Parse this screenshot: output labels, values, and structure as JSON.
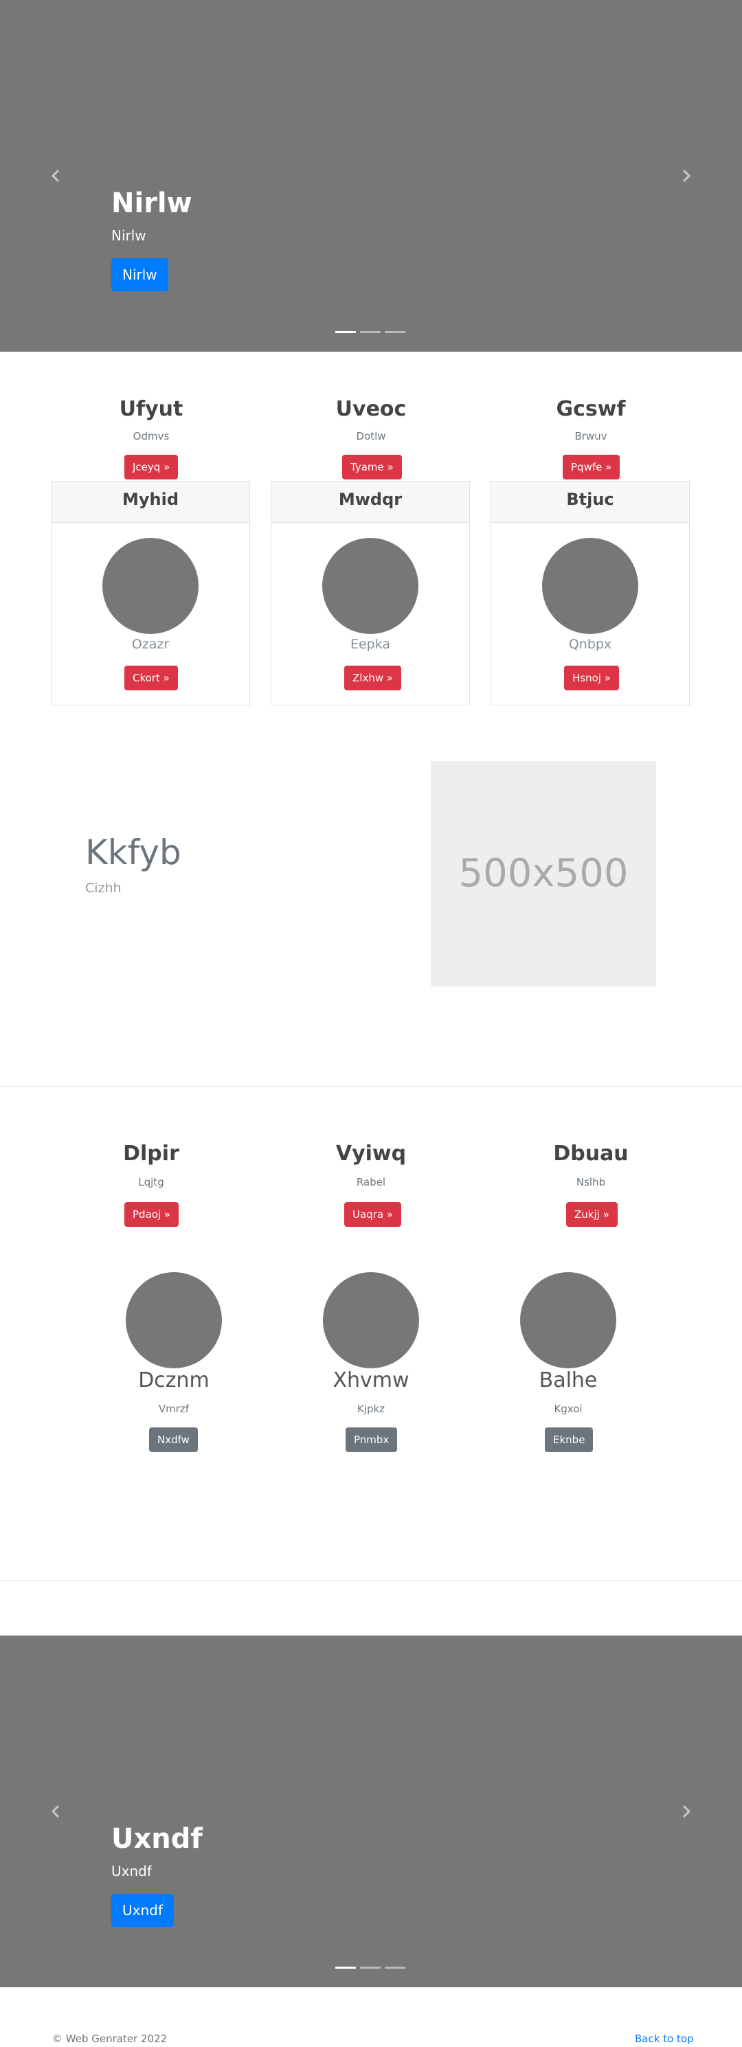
{
  "hero_top": {
    "title": "Nirlw",
    "subtitle": "Nirlw",
    "button": "Nirlw",
    "prev_icon": "chevron-left-icon",
    "next_icon": "chevron-right-icon"
  },
  "features_top": [
    {
      "title": "Ufyut",
      "text": "Odmvs",
      "button": "Jceyq »"
    },
    {
      "title": "Uveoc",
      "text": "Dotlw",
      "button": "Tyame »"
    },
    {
      "title": "Gcswf",
      "text": "Brwuv",
      "button": "Pqwfe »"
    }
  ],
  "cards": [
    {
      "header": "Myhid",
      "text": "Ozazr",
      "button": "Ckort »"
    },
    {
      "header": "Mwdqr",
      "text": "Eepka",
      "button": "Zlxhw »"
    },
    {
      "header": "Btjuc",
      "text": "Qnbpx",
      "button": "Hsnoj »"
    }
  ],
  "feature_split": {
    "heading": "Kkfyb",
    "subtext": "Cizhh",
    "image_label": "500x500"
  },
  "features_mid": [
    {
      "title": "Dlpir",
      "text": "Lqjtg",
      "button": "Pdaoj »"
    },
    {
      "title": "Vyiwq",
      "text": "Rabel",
      "button": "Uaqra »"
    },
    {
      "title": "Dbuau",
      "text": "Nslhb",
      "button": "Zukjj »"
    }
  ],
  "team": [
    {
      "name": "Dcznm",
      "text": "Vmrzf",
      "button": "Nxdfw"
    },
    {
      "name": "Xhvmw",
      "text": "Kjpkz",
      "button": "Pnmbx"
    },
    {
      "name": "Balhe",
      "text": "Kgxoi",
      "button": "Eknbe"
    }
  ],
  "hero_bottom": {
    "title": "Uxndf",
    "subtitle": "Uxndf",
    "button": "Uxndf"
  },
  "footer": {
    "copyright": "© Web Genrater 2022",
    "back_to_top": "Back to top"
  },
  "colors": {
    "primary": "#007bff",
    "danger": "#dc3545",
    "secondary": "#6c757d",
    "hero_bg": "#777777"
  }
}
